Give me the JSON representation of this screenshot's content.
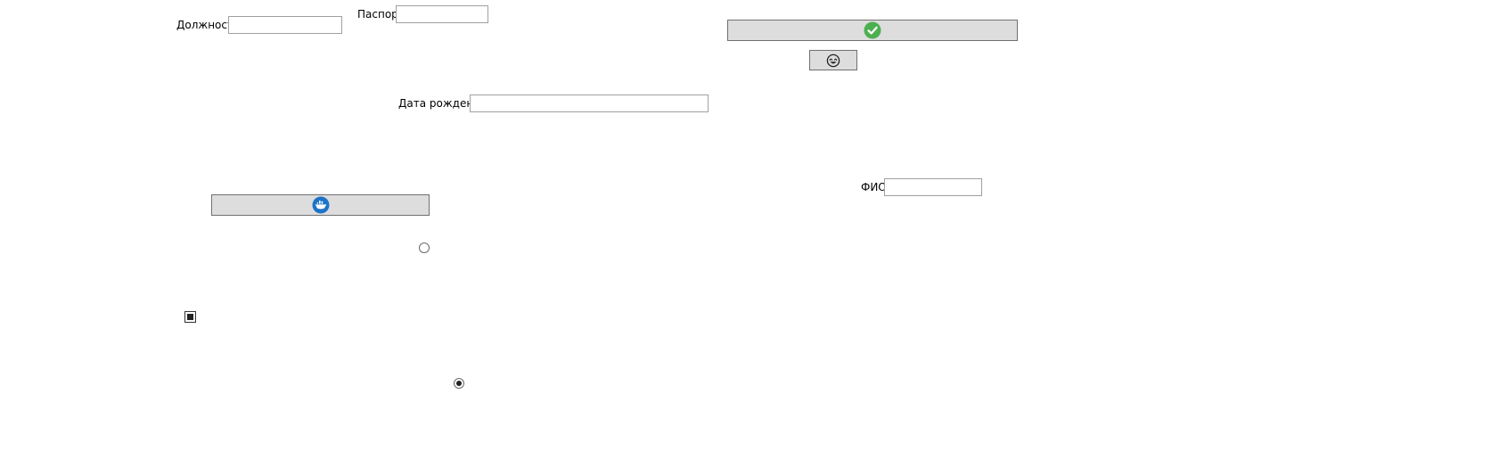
{
  "form": {
    "position": {
      "label": "Должность",
      "value": "",
      "placeholder": ""
    },
    "passport": {
      "label": "Паспорт",
      "value": "",
      "placeholder": ""
    },
    "birth_date": {
      "label": "Дата рождения",
      "value": "",
      "placeholder": ""
    },
    "full_name": {
      "label": "ФИО",
      "value": "",
      "placeholder": ""
    }
  },
  "buttons": {
    "confirm": {
      "icon": "checkmark-icon",
      "accent": "#4caf50"
    },
    "face": {
      "icon": "smiley-face-icon"
    },
    "ship": {
      "icon": "ship-icon",
      "accent": "#1e73c8"
    }
  },
  "controls": {
    "radio_unchecked": {
      "checked": false
    },
    "checkbox": {
      "state": "indeterminate"
    },
    "radio_checked": {
      "checked": true
    }
  },
  "colors": {
    "button_face": "#dddddd",
    "button_border": "#707070",
    "field_border": "#a0a0a0"
  }
}
